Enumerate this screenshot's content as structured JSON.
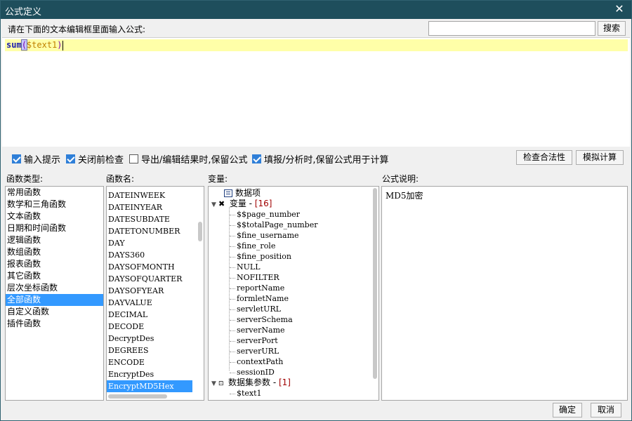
{
  "window": {
    "title": "公式定义",
    "close_icon": "close-icon"
  },
  "prompt": "请在下面的文本编辑框里面输入公式:",
  "search": {
    "placeholder": "",
    "value": "",
    "button": "搜索"
  },
  "editor": {
    "fn": "sum",
    "open": "(",
    "arg": "$text1",
    "close": ")"
  },
  "options": [
    {
      "label": "输入提示",
      "checked": true
    },
    {
      "label": "关闭前检查",
      "checked": true
    },
    {
      "label": "导出/编辑结果时,保留公式",
      "checked": false
    },
    {
      "label": "填报/分析时,保留公式用于计算",
      "checked": true
    }
  ],
  "buttons": {
    "check": "检查合法性",
    "simulate": "模拟计算",
    "ok": "确定",
    "cancel": "取消"
  },
  "columns": {
    "category": "函数类型:",
    "function": "函数名:",
    "variable": "变量:",
    "description": "公式说明:"
  },
  "categories": [
    "常用函数",
    "数学和三角函数",
    "文本函数",
    "日期和时间函数",
    "逻辑函数",
    "数组函数",
    "报表函数",
    "其它函数",
    "层次坐标函数",
    "全部函数",
    "自定义函数",
    "插件函数"
  ],
  "selected_category_index": 9,
  "functions": [
    "DATEINWEEK",
    "DATEINYEAR",
    "DATESUBDATE",
    "DATETONUMBER",
    "DAY",
    "DAYS360",
    "DAYSOFMONTH",
    "DAYSOFQUARTER",
    "DAYSOFYEAR",
    "DAYVALUE",
    "DECIMAL",
    "DECODE",
    "DecryptDes",
    "DEGREES",
    "ENCODE",
    "EncryptDes",
    "EncryptMD5Hex"
  ],
  "selected_function_index": 16,
  "tree": {
    "root1": "数据项",
    "root2_label": "变量 - ",
    "root2_count": "[16]",
    "variables": [
      "$$page_number",
      "$$totalPage_number",
      "$fine_username",
      "$fine_role",
      "$fine_position",
      "NULL",
      "NOFILTER",
      "reportName",
      "formletName",
      "servletURL",
      "serverSchema",
      "serverName",
      "serverPort",
      "serverURL",
      "contextPath",
      "sessionID"
    ],
    "root3_label": "数据集参数 - ",
    "root3_count": "[1]",
    "params": [
      "$text1"
    ]
  },
  "description": "MD5加密"
}
